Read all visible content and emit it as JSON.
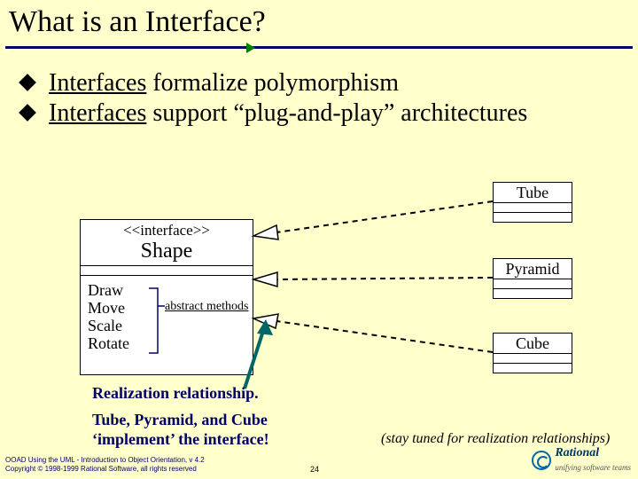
{
  "title": "What is an Interface?",
  "bullets": [
    {
      "prefix": "Interfaces",
      "rest": " formalize polymorphism"
    },
    {
      "prefix": "Interfaces",
      "rest": " support “plug-and-play” architectures"
    }
  ],
  "interface": {
    "stereotype": "<<interface>>",
    "name": "Shape",
    "operations": [
      "Draw",
      "Move",
      "Scale",
      "Rotate"
    ],
    "abstract_label": "abstract methods"
  },
  "classes": {
    "tube": "Tube",
    "pyramid": "Pyramid",
    "cube": "Cube"
  },
  "notes": {
    "realization": "Realization relationship.",
    "implement_line1": "Tube, Pyramid, and Cube",
    "implement_line2": "‘implement’ the interface!",
    "stay_tuned": "(stay tuned for realization relationships)"
  },
  "footer": {
    "line1": "OOAD Using the UML - Introduction to Object Orientation, v 4.2",
    "line2": "Copyright © 1998-1999 Rational Software, all rights reserved"
  },
  "page_number": "24",
  "logo": {
    "brand": "Rational",
    "tagline": "unifying software teams"
  }
}
